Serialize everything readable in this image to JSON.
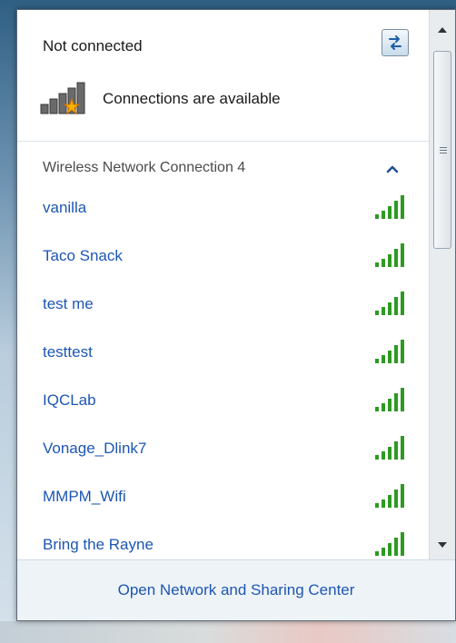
{
  "status": {
    "title": "Not connected",
    "availability": "Connections are available",
    "refresh_icon": "refresh-icon",
    "availability_icon": "signal-bars-with-star-icon"
  },
  "network_group": {
    "label": "Wireless Network Connection 4",
    "collapse_icon": "chevron-up-icon",
    "networks": [
      {
        "name": "vanilla",
        "signal": 5
      },
      {
        "name": "Taco Snack",
        "signal": 5
      },
      {
        "name": "test me",
        "signal": 5
      },
      {
        "name": "testtest",
        "signal": 5
      },
      {
        "name": "IQCLab",
        "signal": 5
      },
      {
        "name": "Vonage_Dlink7",
        "signal": 5
      },
      {
        "name": "MMPM_Wifi",
        "signal": 5
      },
      {
        "name": "Bring the Rayne",
        "signal": 5
      }
    ]
  },
  "footer": {
    "link": "Open Network and Sharing Center"
  },
  "colors": {
    "link": "#1d56b3",
    "signal": "#2e9a22",
    "footer_bg": "#eef3f8"
  }
}
